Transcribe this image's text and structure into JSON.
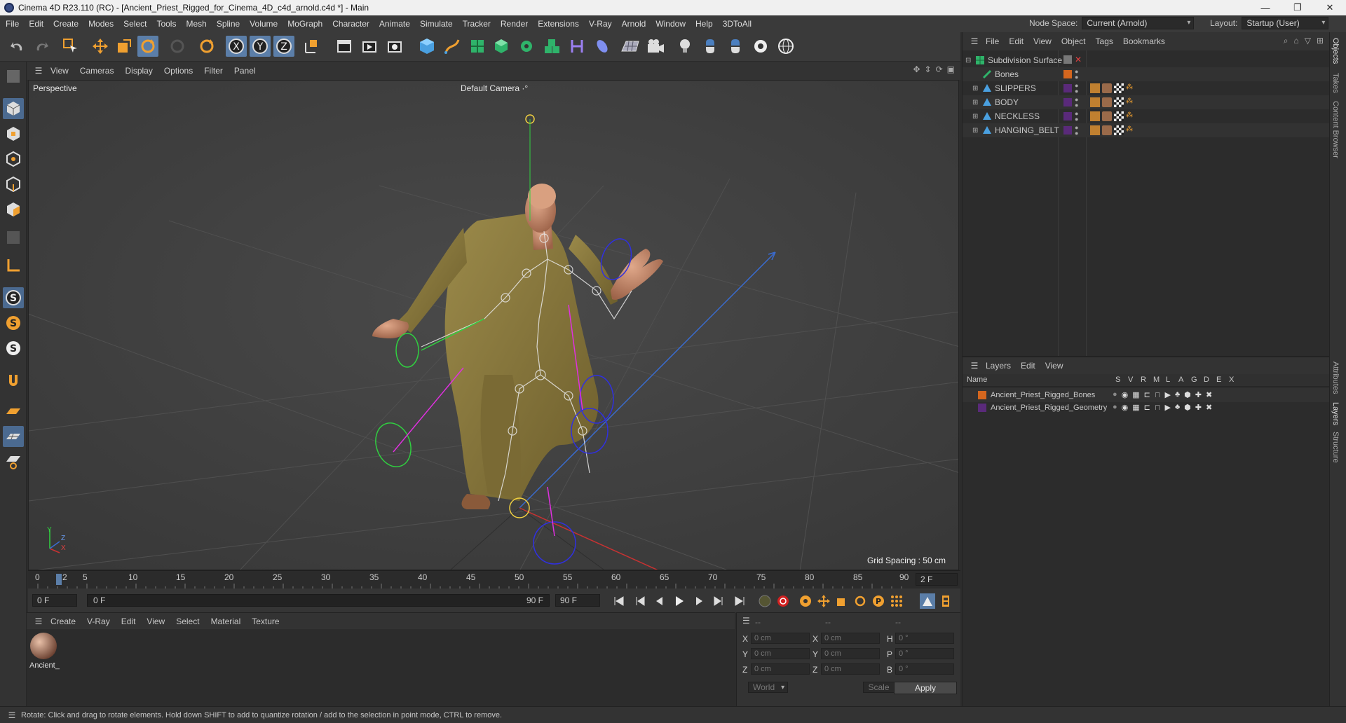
{
  "window": {
    "title": "Cinema 4D R23.110 (RC) - [Ancient_Priest_Rigged_for_Cinema_4D_c4d_arnold.c4d *] - Main",
    "minimize": "—",
    "maximize": "❐",
    "close": "✕"
  },
  "menu": {
    "items": [
      "File",
      "Edit",
      "Create",
      "Modes",
      "Select",
      "Tools",
      "Mesh",
      "Spline",
      "Volume",
      "MoGraph",
      "Character",
      "Animate",
      "Simulate",
      "Tracker",
      "Render",
      "Extensions",
      "V-Ray",
      "Arnold",
      "Window",
      "Help",
      "3DToAll"
    ],
    "node_space_label": "Node Space:",
    "node_space_value": "Current (Arnold)",
    "layout_label": "Layout:",
    "layout_value": "Startup (User)"
  },
  "viewport": {
    "menu": [
      "View",
      "Cameras",
      "Display",
      "Options",
      "Filter",
      "Panel"
    ],
    "projection": "Perspective",
    "camera": "Default Camera",
    "camera_mark": "·°",
    "grid_spacing": "Grid Spacing : 50 cm",
    "axis_x": "X",
    "axis_y": "Y",
    "axis_z": "Z"
  },
  "timeline": {
    "ticks": [
      "0",
      "5",
      "10",
      "15",
      "20",
      "25",
      "30",
      "35",
      "40",
      "45",
      "50",
      "55",
      "60",
      "65",
      "70",
      "75",
      "80",
      "85",
      "90"
    ],
    "current_marker": "2",
    "current_frame": "2 F"
  },
  "transport": {
    "start": "0 F",
    "range_start": "0 F",
    "range_end": "90 F",
    "end": "90 F"
  },
  "materials": {
    "menu": [
      "Create",
      "V-Ray",
      "Edit",
      "View",
      "Select",
      "Material",
      "Texture"
    ],
    "items": [
      {
        "name": "Ancient_"
      }
    ]
  },
  "coords": {
    "headers": [
      "--",
      "--",
      "--"
    ],
    "rows": [
      {
        "a": "X",
        "av": "0 cm",
        "b": "X",
        "bv": "0 cm",
        "c": "H",
        "cv": "0 °"
      },
      {
        "a": "Y",
        "av": "0 cm",
        "b": "Y",
        "bv": "0 cm",
        "c": "P",
        "cv": "0 °"
      },
      {
        "a": "Z",
        "av": "0 cm",
        "b": "Z",
        "bv": "0 cm",
        "c": "B",
        "cv": "0 °"
      }
    ],
    "world": "World",
    "scale": "Scale",
    "apply": "Apply"
  },
  "status": "Rotate: Click and drag to rotate elements. Hold down SHIFT to add to quantize rotation / add to the selection in point mode, CTRL to remove.",
  "objects": {
    "menu": [
      "File",
      "Edit",
      "View",
      "Object",
      "Tags",
      "Bookmarks"
    ],
    "items": [
      {
        "name": "Subdivision Surface",
        "indent": 0,
        "color": "#e0e0e0"
      },
      {
        "name": "Bones",
        "indent": 1,
        "color": "#d8d8d8"
      },
      {
        "name": "SLIPPERS",
        "indent": 1,
        "color": "#d8d8d8"
      },
      {
        "name": "BODY",
        "indent": 1,
        "color": "#d8d8d8"
      },
      {
        "name": "NECKLESS",
        "indent": 1,
        "color": "#d8d8d8"
      },
      {
        "name": "HANGING_BELT",
        "indent": 1,
        "color": "#d8d8d8"
      }
    ]
  },
  "layers": {
    "menu": [
      "Layers",
      "Edit",
      "View"
    ],
    "columns": [
      "Name",
      "S",
      "V",
      "R",
      "M",
      "L",
      "A",
      "G",
      "D",
      "E",
      "X"
    ],
    "items": [
      {
        "name": "Ancient_Priest_Rigged_Bones",
        "color": "#d4661e"
      },
      {
        "name": "Ancient_Priest_Rigged_Geometry",
        "color": "#5a2a7a"
      }
    ]
  },
  "right_tabs": [
    "Objects",
    "Takes",
    "Content Browser",
    "Attributes",
    "Layers",
    "Structure"
  ]
}
